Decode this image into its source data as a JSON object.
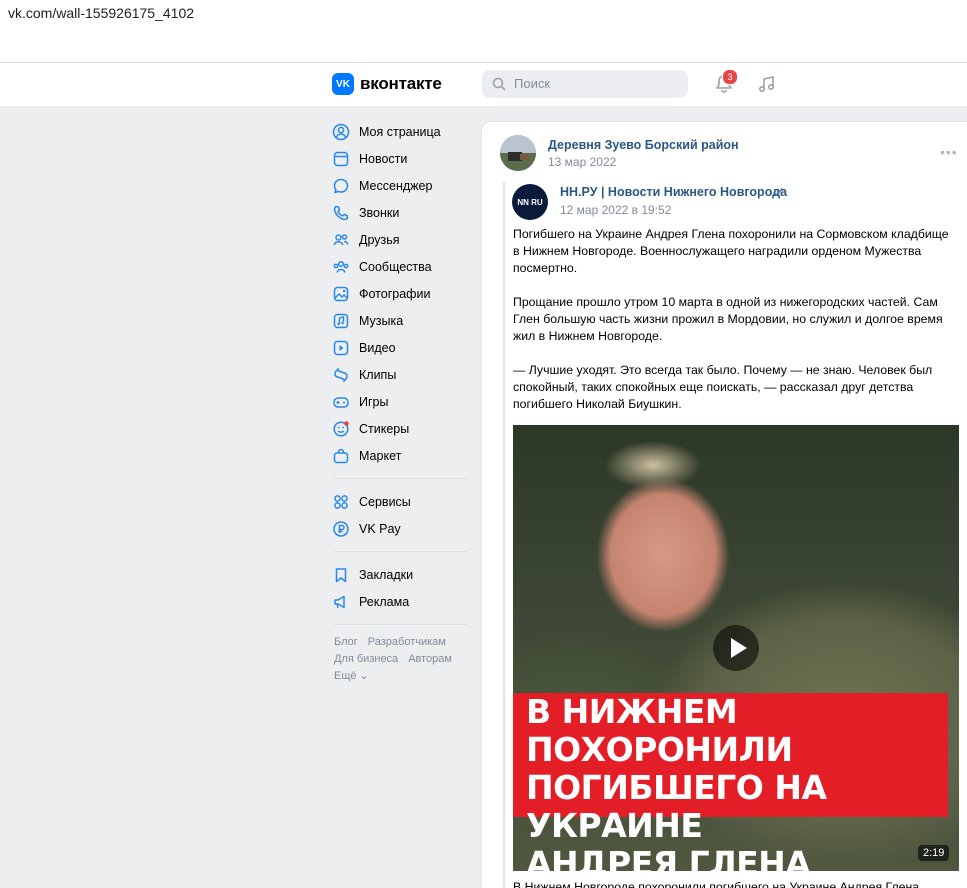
{
  "browser": {
    "url": "vk.com/wall-155926175_4102"
  },
  "header": {
    "logo_text": "вконтакте",
    "logo_mark": "VK",
    "search_placeholder": "Поиск",
    "notifications_count": "3"
  },
  "sidebar": {
    "items": [
      {
        "label": "Моя страница",
        "icon": "user-circle-icon"
      },
      {
        "label": "Новости",
        "icon": "newspaper-icon"
      },
      {
        "label": "Мессенджер",
        "icon": "chat-bubble-icon"
      },
      {
        "label": "Звонки",
        "icon": "phone-icon"
      },
      {
        "label": "Друзья",
        "icon": "friends-icon"
      },
      {
        "label": "Сообщества",
        "icon": "community-icon"
      },
      {
        "label": "Фотографии",
        "icon": "photo-icon"
      },
      {
        "label": "Музыка",
        "icon": "music-icon"
      },
      {
        "label": "Видео",
        "icon": "video-icon"
      },
      {
        "label": "Клипы",
        "icon": "clips-icon"
      },
      {
        "label": "Игры",
        "icon": "gamepad-icon"
      },
      {
        "label": "Стикеры",
        "icon": "sticker-icon"
      },
      {
        "label": "Маркет",
        "icon": "market-bag-icon"
      }
    ],
    "items2": [
      {
        "label": "Сервисы",
        "icon": "services-grid-icon"
      },
      {
        "label": "VK Pay",
        "icon": "vkpay-icon"
      }
    ],
    "items3": [
      {
        "label": "Закладки",
        "icon": "bookmark-icon"
      },
      {
        "label": "Реклама",
        "icon": "megaphone-icon"
      }
    ],
    "footer": {
      "links_row1": [
        "Блог",
        "Разработчикам"
      ],
      "links_row2": [
        "Для бизнеса",
        "Авторам"
      ],
      "more": "Ещё"
    }
  },
  "post": {
    "author": "Деревня Зуево Борский район",
    "date": "13 мар 2022",
    "repost": {
      "author": "НН.РУ | Новости Нижнего Новгорода",
      "avatar_text": "NN RU",
      "date": "12 мар 2022 в 19:52",
      "paragraphs": [
        "Погибшего на Украине Андрея Глена похоронили на Сормовском кладбище в Нижнем Новгороде. Военнослужащего наградили орденом Мужества посмертно.",
        "Прощание прошло утром 10 марта в одной из нижегородских частей. Сам Глен большую часть жизни прожил в Мордовии, но служил и долгое время жил в Нижнем Новгороде.",
        "— Лучшие уходят. Это всегда так было. Почему — не знаю. Человек был спокойный, таких спокойных еще поискать, — рассказал друг детства погибшего Николай Биушкин."
      ],
      "video": {
        "overlay_title": "В НИЖНЕМ ПОХОРОНИЛИ\nПОГИБШЕГО НА УКРАИНЕ\nАНДРЕЯ ГЛЕНА",
        "duration": "2:19"
      },
      "cut_text": "В Нижнем Новгороде похоронили погибшего на Украине Андрея Глена"
    }
  },
  "colors": {
    "accent": "#0077ff",
    "link": "#2a5885",
    "banner": "#e41e26"
  }
}
